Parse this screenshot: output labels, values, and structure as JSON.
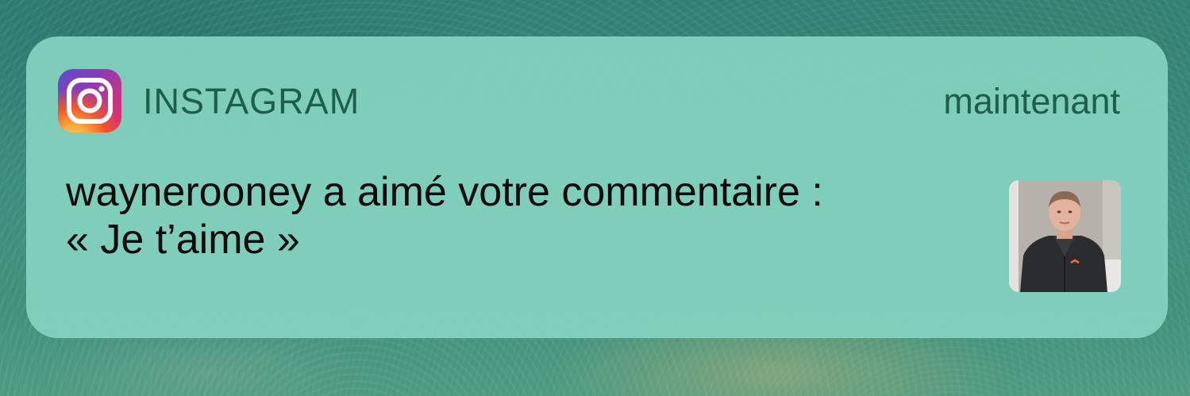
{
  "notification": {
    "app_name": "INSTAGRAM",
    "timestamp": "maintenant",
    "message_line1": "waynerooney a aimé votre commentaire :",
    "message_line2": "« Je t’aime »",
    "app_icon": "instagram-icon",
    "thumbnail": "profile-photo"
  }
}
